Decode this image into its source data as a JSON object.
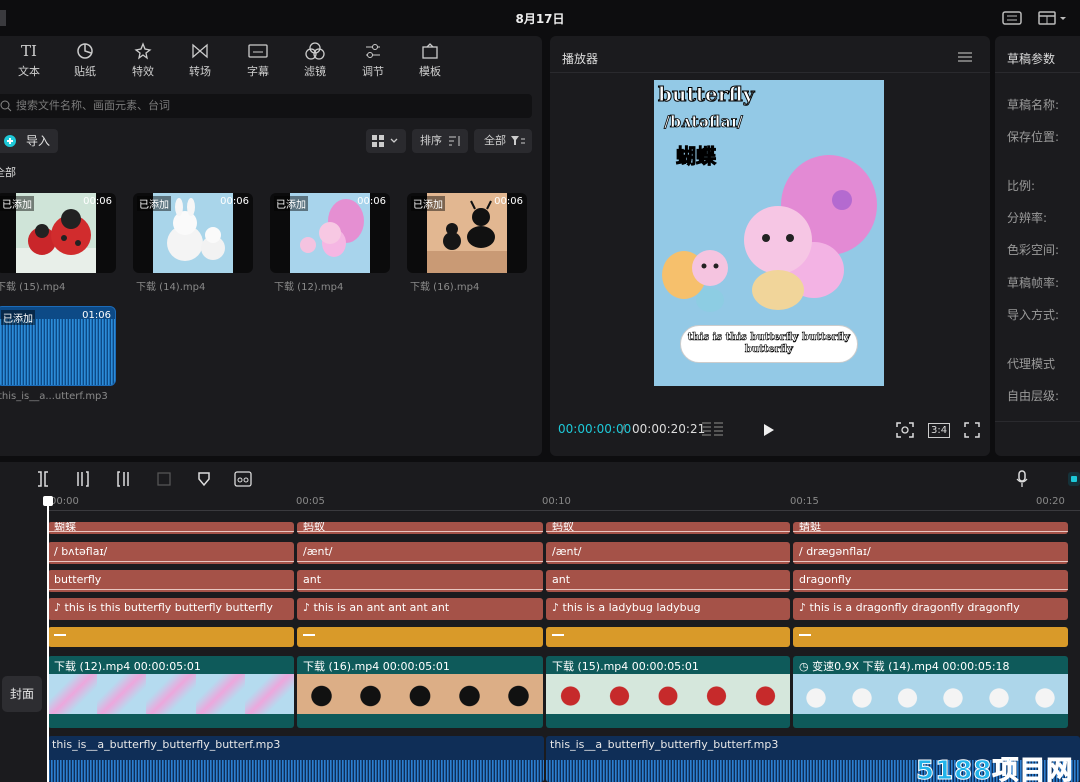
{
  "titlebar": {
    "date": "8月17日"
  },
  "media_toolbar": {
    "tabs": [
      {
        "label": "文本",
        "icon": "text-icon"
      },
      {
        "label": "贴纸",
        "icon": "sticker-icon"
      },
      {
        "label": "特效",
        "icon": "effects-icon"
      },
      {
        "label": "转场",
        "icon": "transition-icon"
      },
      {
        "label": "字幕",
        "icon": "subtitle-icon"
      },
      {
        "label": "滤镜",
        "icon": "filter-icon"
      },
      {
        "label": "调节",
        "icon": "adjust-icon"
      },
      {
        "label": "模板",
        "icon": "template-icon"
      }
    ]
  },
  "media": {
    "search_placeholder": "搜索文件名称、画面元素、台词",
    "import_label": "导入",
    "sort_label": "排序",
    "filter_label": "全部",
    "all_label": "全部",
    "items": [
      {
        "added": "已添加",
        "duration": "00:06",
        "name": "下载 (15).mp4"
      },
      {
        "added": "已添加",
        "duration": "00:06",
        "name": "下载 (14).mp4"
      },
      {
        "added": "已添加",
        "duration": "00:06",
        "name": "下载 (12).mp4"
      },
      {
        "added": "已添加",
        "duration": "00:06",
        "name": "下载 (16).mp4"
      },
      {
        "added": "已添加",
        "duration": "01:06",
        "name": "this_is__a...utterf.mp3"
      }
    ]
  },
  "player": {
    "title": "播放器",
    "preview_word": "butterfly",
    "preview_phonetic": "/bʌtəflaɪ/",
    "preview_chinese": "蝴蝶",
    "preview_subtitle": "this is this butterfly butterfly butterfly",
    "current_time": "00:00:00:00",
    "separator": "/",
    "total_time": "00:00:20:21",
    "ratio_label": "3:4"
  },
  "params": {
    "title": "草稿参数",
    "labels": [
      "草稿名称:",
      "保存位置:",
      "比例:",
      "分辨率:",
      "色彩空间:",
      "草稿帧率:",
      "导入方式:",
      "代理模式",
      "自由层级:"
    ]
  },
  "timeline": {
    "ticks": [
      "00:00",
      "00:05",
      "00:10",
      "00:15",
      "00:20"
    ],
    "cover_label": "封面",
    "track_top": [
      "蝴蝶",
      "蚂蚁",
      "蚂蚁",
      "蜻蜓"
    ],
    "track_phonetic": [
      "/ bʌtəflaɪ/",
      "/ænt/",
      "/ænt/",
      "/ dræɡənflaɪ/"
    ],
    "track_word": [
      "butterfly",
      "ant",
      "ant",
      "dragonfly"
    ],
    "track_sentence": [
      "this is this butterfly butterfly butterfly",
      "this is an ant ant ant ant",
      "this is a ladybug ladybug",
      "this is a dragonfly dragonfly dragonfly"
    ],
    "video_clips": [
      {
        "name": "下载 (12).mp4",
        "duration": "00:00:05:01",
        "speed": ""
      },
      {
        "name": "下载 (16).mp4",
        "duration": "00:00:05:01",
        "speed": ""
      },
      {
        "name": "下载 (15).mp4",
        "duration": "00:00:05:01",
        "speed": ""
      },
      {
        "name": "下载 (14).mp4",
        "duration": "00:00:05:18",
        "speed": "变速0.9X"
      }
    ],
    "audio_clips": [
      "this_is__a_butterfly_butterfly_butterf.mp3",
      "this_is__a_butterfly_butterfly_butterf.mp3"
    ]
  },
  "watermark": "5188项目网",
  "colors": {
    "accent": "#1ec9d8",
    "caption_clip": "#a55248",
    "effect_clip": "#d99a29",
    "video_clip": "#0e5a5a",
    "audio_clip": "#0f2e57"
  }
}
